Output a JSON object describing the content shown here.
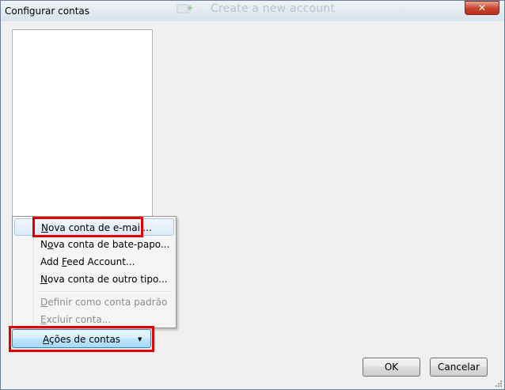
{
  "window": {
    "title": "Configurar contas",
    "background_title": "Create a new account",
    "close_symbol": "✕"
  },
  "menu": {
    "items": [
      {
        "label": "Nova conta de e-mail...",
        "mnemonic_index": 0,
        "enabled": true,
        "hover": true
      },
      {
        "label": "Nova conta de bate-papo...",
        "mnemonic_index": 1,
        "enabled": true,
        "hover": false
      },
      {
        "label": "Add Feed Account...",
        "mnemonic_index": 4,
        "enabled": true,
        "hover": false
      },
      {
        "label": "Nova conta de outro tipo...",
        "mnemonic_index": 0,
        "enabled": true,
        "hover": false
      },
      {
        "label": "Definir como conta padrão",
        "mnemonic_index": 0,
        "enabled": false,
        "hover": false
      },
      {
        "label": "Excluir conta...",
        "mnemonic_index": 0,
        "enabled": false,
        "hover": false
      }
    ]
  },
  "actions_button": {
    "label": "Ações de contas",
    "arrow": "▼"
  },
  "buttons": {
    "ok": "OK",
    "cancel": "Cancelar"
  },
  "colors": {
    "highlight": "#e00000",
    "accent": "#3c7fb1"
  }
}
